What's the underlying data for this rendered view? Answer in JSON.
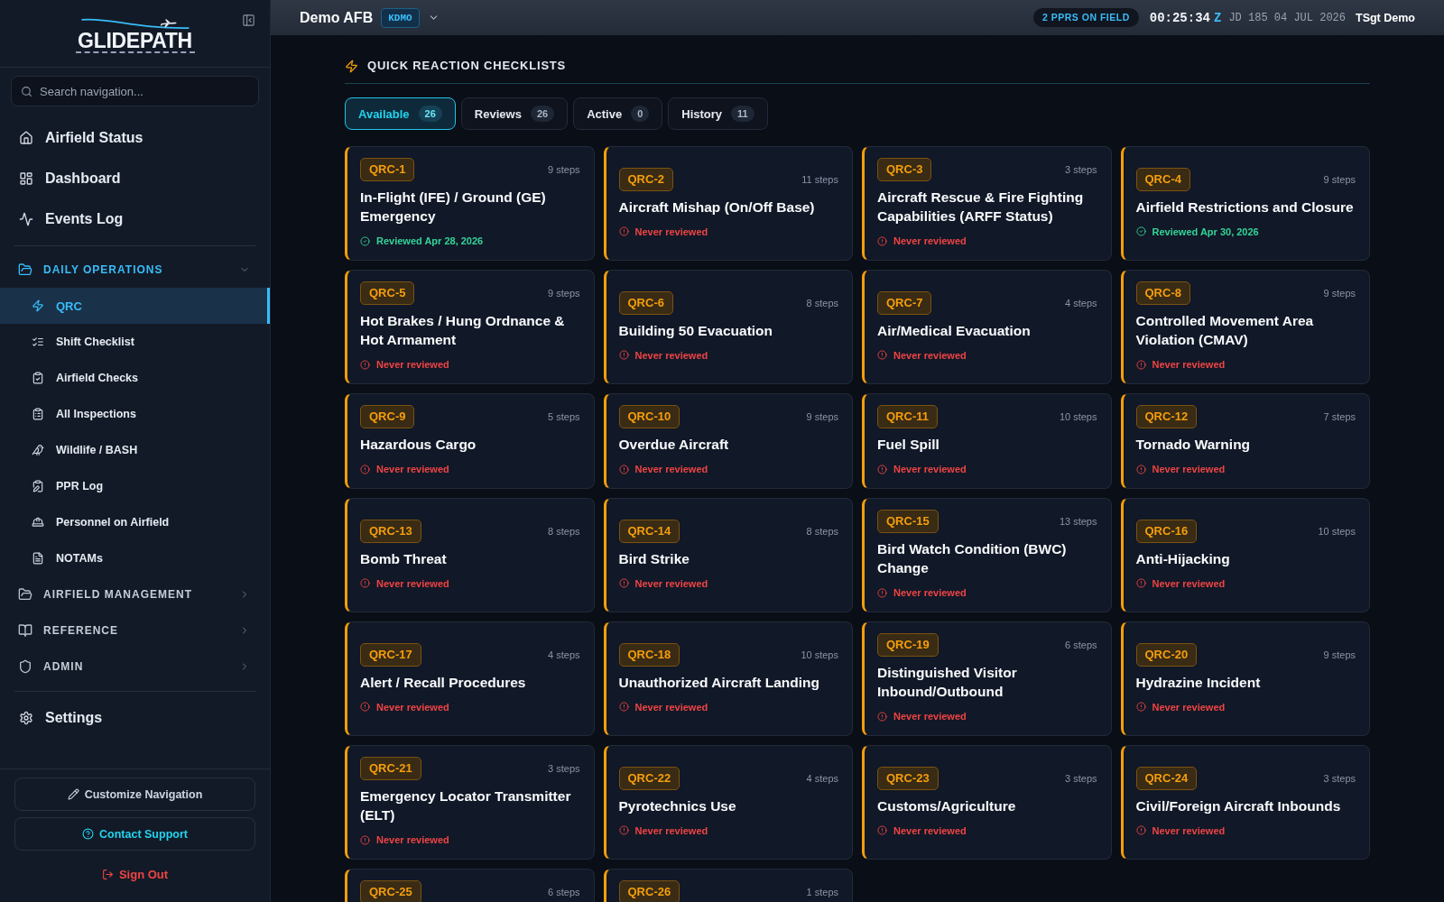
{
  "sidebar": {
    "logo": "GLIDEPATH",
    "search": {
      "placeholder": "Search navigation..."
    },
    "items": [
      {
        "label": "Airfield Status"
      },
      {
        "label": "Dashboard"
      },
      {
        "label": "Events Log"
      }
    ],
    "groups": [
      {
        "label": "DAILY OPERATIONS",
        "expanded": true,
        "children": [
          {
            "label": "QRC",
            "selected": true
          },
          {
            "label": "Shift Checklist",
            "selected": false
          },
          {
            "label": "Airfield Checks",
            "selected": false
          },
          {
            "label": "All Inspections",
            "selected": false
          },
          {
            "label": "Wildlife / BASH",
            "selected": false
          },
          {
            "label": "PPR Log",
            "selected": false
          },
          {
            "label": "Personnel on Airfield",
            "selected": false
          },
          {
            "label": "NOTAMs",
            "selected": false
          }
        ]
      },
      {
        "label": "AIRFIELD MANAGEMENT",
        "expanded": false
      },
      {
        "label": "REFERENCE",
        "expanded": false
      },
      {
        "label": "ADMIN",
        "expanded": false
      }
    ],
    "settings": "Settings",
    "buttons": {
      "customize": "Customize Navigation",
      "support": "Contact Support",
      "sign_out": "Sign Out"
    }
  },
  "header": {
    "base_name": "Demo AFB",
    "airfield_code": "KDMO",
    "ppr_pill": "2 PPRS ON FIELD",
    "clock": {
      "time": "00:25:34",
      "zone": "Z",
      "date": "JD 185 04 JUL 2026"
    },
    "user": "TSgt Demo"
  },
  "page": {
    "title": "QUICK REACTION CHECKLISTS",
    "tabs": [
      {
        "label": "Available",
        "count": "26",
        "selected": true
      },
      {
        "label": "Reviews",
        "count": "26",
        "selected": false
      },
      {
        "label": "Active",
        "count": "0",
        "selected": false
      },
      {
        "label": "History",
        "count": "11",
        "selected": false
      }
    ],
    "cards": [
      {
        "code": "QRC-1",
        "steps": "9 steps",
        "title": "In-Flight (IFE) / Ground (GE) Emergency",
        "review": {
          "kind": "reviewed",
          "text": "Reviewed Apr 28, 2026"
        }
      },
      {
        "code": "QRC-2",
        "steps": "11 steps",
        "title": "Aircraft Mishap (On/Off Base)",
        "review": {
          "kind": "never",
          "text": "Never reviewed"
        }
      },
      {
        "code": "QRC-3",
        "steps": "3 steps",
        "title": "Aircraft Rescue & Fire Fighting Capabilities (ARFF Status)",
        "review": {
          "kind": "never",
          "text": "Never reviewed"
        }
      },
      {
        "code": "QRC-4",
        "steps": "9 steps",
        "title": "Airfield Restrictions and Closure",
        "review": {
          "kind": "reviewed",
          "text": "Reviewed Apr 30, 2026"
        }
      },
      {
        "code": "QRC-5",
        "steps": "9 steps",
        "title": "Hot Brakes / Hung Ordnance & Hot Armament",
        "review": {
          "kind": "never",
          "text": "Never reviewed"
        }
      },
      {
        "code": "QRC-6",
        "steps": "8 steps",
        "title": "Building 50 Evacuation",
        "review": {
          "kind": "never",
          "text": "Never reviewed"
        }
      },
      {
        "code": "QRC-7",
        "steps": "4 steps",
        "title": "Air/Medical Evacuation",
        "review": {
          "kind": "never",
          "text": "Never reviewed"
        }
      },
      {
        "code": "QRC-8",
        "steps": "9 steps",
        "title": "Controlled Movement Area Violation (CMAV)",
        "review": {
          "kind": "never",
          "text": "Never reviewed"
        }
      },
      {
        "code": "QRC-9",
        "steps": "5 steps",
        "title": "Hazardous Cargo",
        "review": {
          "kind": "never",
          "text": "Never reviewed"
        }
      },
      {
        "code": "QRC-10",
        "steps": "9 steps",
        "title": "Overdue Aircraft",
        "review": {
          "kind": "never",
          "text": "Never reviewed"
        }
      },
      {
        "code": "QRC-11",
        "steps": "10 steps",
        "title": "Fuel Spill",
        "review": {
          "kind": "never",
          "text": "Never reviewed"
        }
      },
      {
        "code": "QRC-12",
        "steps": "7 steps",
        "title": "Tornado Warning",
        "review": {
          "kind": "never",
          "text": "Never reviewed"
        }
      },
      {
        "code": "QRC-13",
        "steps": "8 steps",
        "title": "Bomb Threat",
        "review": {
          "kind": "never",
          "text": "Never reviewed"
        }
      },
      {
        "code": "QRC-14",
        "steps": "8 steps",
        "title": "Bird Strike",
        "review": {
          "kind": "never",
          "text": "Never reviewed"
        }
      },
      {
        "code": "QRC-15",
        "steps": "13 steps",
        "title": "Bird Watch Condition (BWC) Change",
        "review": {
          "kind": "never",
          "text": "Never reviewed"
        }
      },
      {
        "code": "QRC-16",
        "steps": "10 steps",
        "title": "Anti-Hijacking",
        "review": {
          "kind": "never",
          "text": "Never reviewed"
        }
      },
      {
        "code": "QRC-17",
        "steps": "4 steps",
        "title": "Alert / Recall Procedures",
        "review": {
          "kind": "never",
          "text": "Never reviewed"
        }
      },
      {
        "code": "QRC-18",
        "steps": "10 steps",
        "title": "Unauthorized Aircraft Landing",
        "review": {
          "kind": "never",
          "text": "Never reviewed"
        }
      },
      {
        "code": "QRC-19",
        "steps": "6 steps",
        "title": "Distinguished Visitor Inbound/Outbound",
        "review": {
          "kind": "never",
          "text": "Never reviewed"
        }
      },
      {
        "code": "QRC-20",
        "steps": "9 steps",
        "title": "Hydrazine Incident",
        "review": {
          "kind": "never",
          "text": "Never reviewed"
        }
      },
      {
        "code": "QRC-21",
        "steps": "3 steps",
        "title": "Emergency Locator Transmitter (ELT)",
        "review": {
          "kind": "never",
          "text": "Never reviewed"
        }
      },
      {
        "code": "QRC-22",
        "steps": "4 steps",
        "title": "Pyrotechnics Use",
        "review": {
          "kind": "never",
          "text": "Never reviewed"
        }
      },
      {
        "code": "QRC-23",
        "steps": "3 steps",
        "title": "Customs/Agriculture",
        "review": {
          "kind": "never",
          "text": "Never reviewed"
        }
      },
      {
        "code": "QRC-24",
        "steps": "3 steps",
        "title": "Civil/Foreign Aircraft Inbounds",
        "review": {
          "kind": "never",
          "text": "Never reviewed"
        }
      },
      {
        "code": "QRC-25",
        "steps": "6 steps"
      },
      {
        "code": "QRC-26",
        "steps": "1 steps"
      }
    ]
  }
}
